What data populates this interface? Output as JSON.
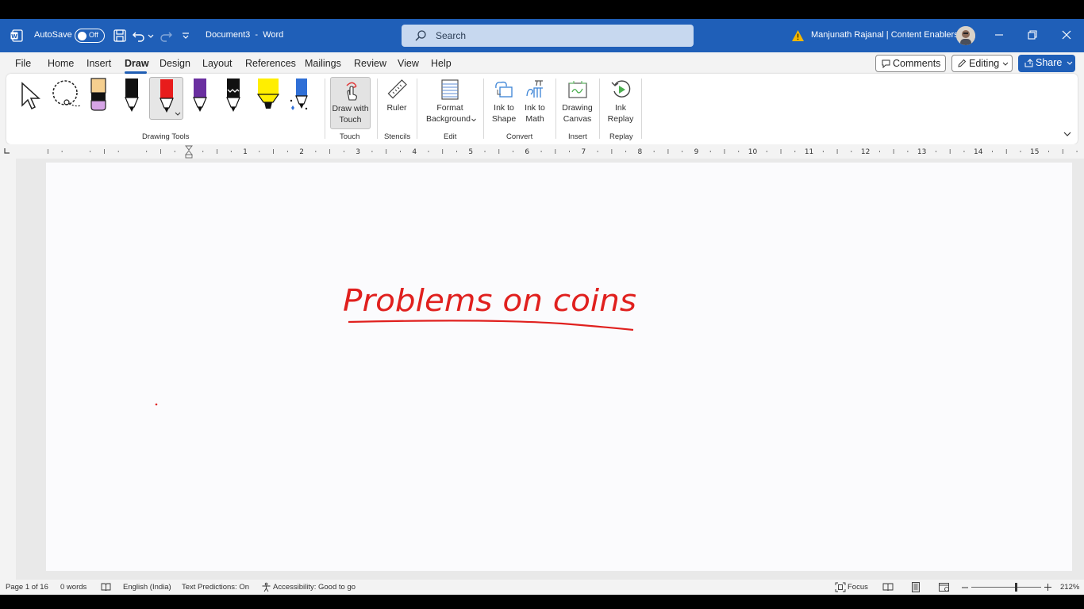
{
  "titlebar": {
    "autosave_label": "AutoSave",
    "autosave_state": "Off",
    "document_title": "Document3",
    "separator": "-",
    "app_name": "Word",
    "search_placeholder": "Search",
    "user_name": "Manjunath Rajanal | Content Enablers"
  },
  "tabs": [
    {
      "label": "File"
    },
    {
      "label": "Home"
    },
    {
      "label": "Insert"
    },
    {
      "label": "Draw"
    },
    {
      "label": "Design"
    },
    {
      "label": "Layout"
    },
    {
      "label": "References"
    },
    {
      "label": "Mailings"
    },
    {
      "label": "Review"
    },
    {
      "label": "View"
    },
    {
      "label": "Help"
    }
  ],
  "active_tab": "Draw",
  "actions": {
    "comments": "Comments",
    "editing": "Editing",
    "share": "Share"
  },
  "ribbon": {
    "groups": {
      "drawing_tools": "Drawing Tools",
      "touch": "Touch",
      "stencils": "Stencils",
      "edit": "Edit",
      "convert": "Convert",
      "insert": "Insert",
      "replay": "Replay"
    },
    "buttons": {
      "draw_with_touch_1": "Draw with",
      "draw_with_touch_2": "Touch",
      "ruler": "Ruler",
      "format_bg_1": "Format",
      "format_bg_2": "Background",
      "ink_to_shape_1": "Ink to",
      "ink_to_shape_2": "Shape",
      "ink_to_math_1": "Ink to",
      "ink_to_math_2": "Math",
      "drawing_canvas_1": "Drawing",
      "drawing_canvas_2": "Canvas",
      "ink_replay_1": "Ink",
      "ink_replay_2": "Replay"
    },
    "pens": [
      {
        "name": "select-tool",
        "color": "#000000"
      },
      {
        "name": "lasso-tool",
        "color": "#000000"
      },
      {
        "name": "eraser",
        "color": "#f2c28a"
      },
      {
        "name": "pen-black",
        "color": "#111111"
      },
      {
        "name": "pen-red",
        "color": "#e81c1c"
      },
      {
        "name": "pen-purple",
        "color": "#6a2fa0"
      },
      {
        "name": "pen-black-galaxy",
        "color": "#111111"
      },
      {
        "name": "highlighter-yellow",
        "color": "#ffee00"
      },
      {
        "name": "pen-blue-sparkle",
        "color": "#2f6fd6"
      }
    ]
  },
  "ruler": {
    "numbers": [
      "1",
      "2",
      "3",
      "4",
      "5",
      "6",
      "7",
      "8",
      "9",
      "10",
      "11",
      "12",
      "13",
      "14",
      "15"
    ]
  },
  "document": {
    "handwritten_text": "Problems on coins",
    "ink_color": "#e0201e"
  },
  "statusbar": {
    "page": "Page 1 of 16",
    "words": "0 words",
    "language": "English (India)",
    "text_predictions": "Text Predictions: On",
    "accessibility": "Accessibility: Good to go",
    "focus": "Focus",
    "zoom": "212%"
  },
  "colors": {
    "titlebar": "#1f5fb8",
    "accent": "#1f5fb8",
    "ribbon_bg": "#f3f3f3"
  }
}
